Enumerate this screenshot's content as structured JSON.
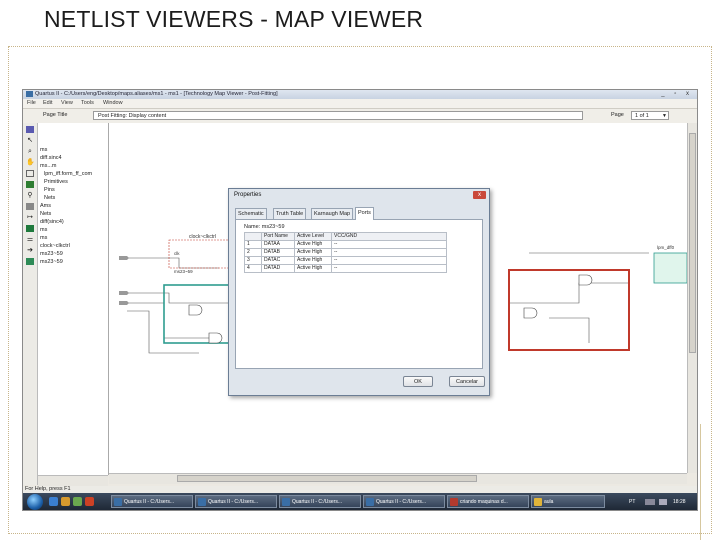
{
  "slide": {
    "title": "NETLIST VIEWERS  - MAP VIEWER"
  },
  "window": {
    "title": "Quartus II - C:/Users/eng/Desktop/maps.aliases/ms1 - ms1 - [Technology Map Viewer - Post-Fitting]",
    "controls": "_ ▫ x"
  },
  "menu": [
    "File",
    "Edit",
    "View",
    "Tools",
    "Window"
  ],
  "toolbar": {
    "page_title_label": "Page Title",
    "page_title_value": "Post Fitting: Display content",
    "page_label": "Page",
    "page_value": "1 of 1"
  },
  "tree": {
    "items": [
      "ms",
      "diff.sinc4",
      "ms...m",
      "lpm_iff.form_ff_com",
      "Primitives",
      "Pins",
      "Nets",
      "Ams",
      "Nets",
      "diff(sinc4)",
      "ms",
      "ms",
      "clock~clkctrl",
      "ms23~59",
      "ms23~59"
    ]
  },
  "left_tools": [
    "select-icon",
    "hand-icon",
    "zoom-icon",
    "fit-icon",
    "find-icon",
    "back-icon",
    "forward-icon",
    "hierarchy-icon",
    "net-icon",
    "pin-icon",
    "node-icon",
    "bus-icon",
    "wire-icon",
    "color-icon",
    "filter-icon",
    "gates-icon"
  ],
  "schematic": {
    "block_top_label": "clock~clkctrl",
    "block_top_sub": "clk",
    "block_bottom_label": "ms23~59",
    "right_block_label": "lpm_dff0"
  },
  "status": {
    "text": "For Help, press F1"
  },
  "taskbar": {
    "tasks": [
      {
        "label": "Quartus II - C:/Users...",
        "color": "#3a6ea5"
      },
      {
        "label": "Quartus II - C:/Users...",
        "color": "#3a6ea5"
      },
      {
        "label": "Quartus II - C:/Users...",
        "color": "#3a6ea5"
      },
      {
        "label": "Quartus II - C:/Users...",
        "color": "#3a6ea5"
      },
      {
        "label": "criando maquinas d...",
        "color": "#b23a2e"
      },
      {
        "label": "aula",
        "color": "#e0b43a"
      }
    ],
    "tray_lang": "PT",
    "tray_time": "18:28"
  },
  "dialog": {
    "title": "Properties",
    "close_label": "x",
    "tabs": [
      "Schematic",
      "Truth Table",
      "Karnaugh Map",
      "Ports"
    ],
    "active_tab": 3,
    "name_label": "Name:",
    "name_value": "ms23~59",
    "columns": [
      "",
      "Port Name",
      "Active Level",
      "VCC/GND"
    ],
    "rows": [
      [
        "1",
        "DATAA",
        "Active High",
        "--"
      ],
      [
        "2",
        "DATAB",
        "Active High",
        "--"
      ],
      [
        "3",
        "DATAC",
        "Active High",
        "--"
      ],
      [
        "4",
        "DATAD",
        "Active High",
        "--"
      ]
    ],
    "ok_label": "OK",
    "cancel_label": "Cancelar"
  }
}
